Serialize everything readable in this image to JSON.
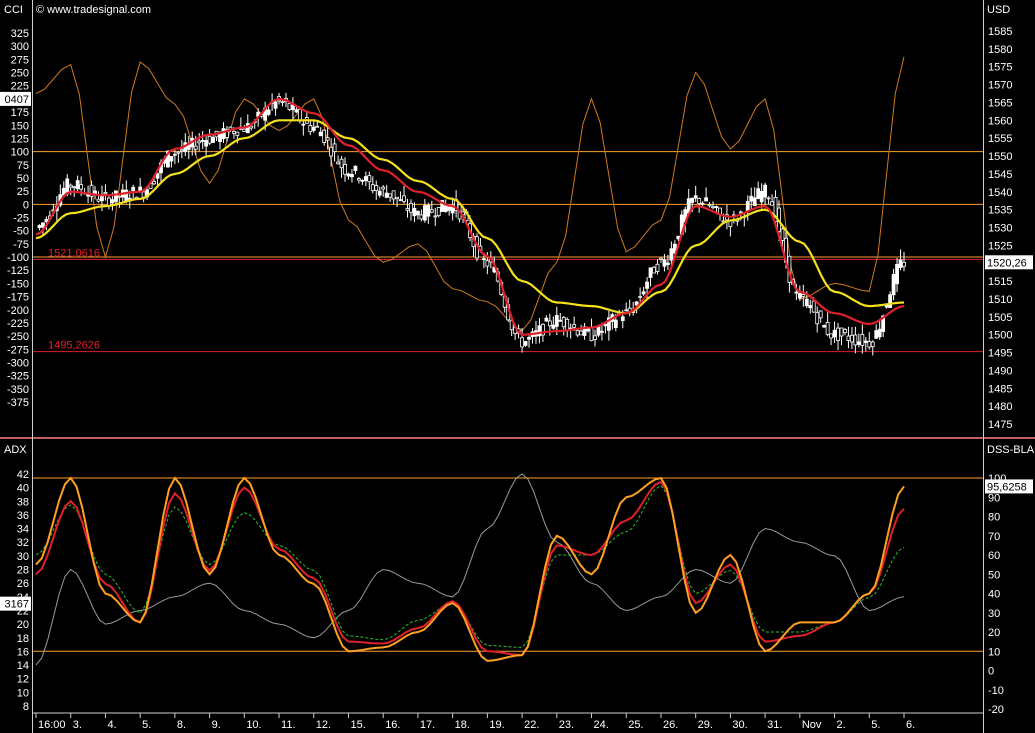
{
  "header": {
    "left_indicator": "CCI",
    "copyright": "© www.tradesignal.com",
    "currency": "USD",
    "adx_label": "ADX",
    "dss_label": "DSS-BLAU"
  },
  "upper_panel": {
    "cci_axis_ticks": [
      325,
      300,
      275,
      250,
      225,
      200,
      175,
      150,
      125,
      100,
      75,
      50,
      25,
      0,
      -25,
      -50,
      -75,
      -100,
      -125,
      -150,
      -175,
      -200,
      -225,
      -250,
      -275,
      -300,
      -325,
      -350,
      -375
    ],
    "cci_current_tag": "0407",
    "price_axis_ticks": [
      1585,
      1580,
      1575,
      1570,
      1565,
      1560,
      1555,
      1550,
      1545,
      1540,
      1535,
      1530,
      1525,
      1520,
      1515,
      1510,
      1505,
      1500,
      1495,
      1490,
      1485,
      1480,
      1475
    ],
    "price_current_tag": "1520,26",
    "level_lines": [
      {
        "kind": "cci",
        "value": 100,
        "color": "#ff9f2e"
      },
      {
        "kind": "cci",
        "value": 0,
        "color": "#ff9f2e"
      },
      {
        "kind": "cci",
        "value": -100,
        "color": "#ff9f2e"
      },
      {
        "kind": "price",
        "value": 1521.0616,
        "color": "#e0202a"
      },
      {
        "kind": "price",
        "value": 1495.2626,
        "color": "#e0202a"
      }
    ],
    "level_labels": [
      "1521,0616",
      "1495,2626"
    ]
  },
  "lower_panel": {
    "adx_axis_ticks": [
      42,
      40,
      38,
      36,
      34,
      32,
      30,
      28,
      26,
      24,
      22,
      20,
      18,
      16,
      14,
      12,
      10,
      8
    ],
    "adx_current_tag": "3167",
    "dss_axis_ticks": [
      100,
      90,
      80,
      70,
      60,
      50,
      40,
      30,
      20,
      10,
      0,
      -10,
      -20
    ],
    "dss_current_tag": "95,6258",
    "level_lines": [
      {
        "value": 100,
        "color": "#ff9f2e"
      },
      {
        "value": 10,
        "color": "#ff9f2e"
      }
    ]
  },
  "x_axis": {
    "labels": [
      "16:00",
      "3.",
      "4.",
      "5.",
      "8.",
      "9.",
      "10.",
      "11.",
      "12.",
      "15.",
      "16.",
      "17.",
      "18.",
      "19.",
      "22.",
      "23.",
      "24.",
      "25.",
      "26.",
      "29.",
      "30.",
      "31.",
      "Nov",
      "2.",
      "5.",
      "6."
    ]
  },
  "colors": {
    "background": "#000000",
    "candle": "#ffffff",
    "ma_fast": "#e0202a",
    "ma_slow": "#f4e11c",
    "cci": "#d07a1e",
    "dss_main": "#ffa020",
    "dss_signal": "#e0202a",
    "dss_dashed": "#2fbf2f",
    "adx": "#9a9a9a",
    "divider": "#ff7a7a",
    "axis_text": "#ffffff"
  },
  "chart_data": [
    {
      "type": "candlestick",
      "title": "",
      "ylabel": "USD",
      "ylim": [
        1470,
        1590
      ],
      "x": [
        "16:00",
        "3.",
        "4.",
        "5.",
        "8.",
        "9.",
        "10.",
        "11.",
        "12.",
        "15.",
        "16.",
        "17.",
        "18.",
        "19.",
        "22.",
        "23.",
        "24.",
        "25.",
        "26.",
        "29.",
        "30.",
        "31.",
        "Nov",
        "2.",
        "5.",
        "6."
      ],
      "series": [
        {
          "name": "close",
          "values": [
            1530,
            1542,
            1538,
            1540,
            1551,
            1555,
            1558,
            1565,
            1558,
            1546,
            1540,
            1534,
            1536,
            1520,
            1498,
            1504,
            1500,
            1506,
            1520,
            1538,
            1532,
            1540,
            1510,
            1500,
            1498,
            1520.26
          ]
        },
        {
          "name": "ma_fast",
          "values": [
            1528,
            1540,
            1539,
            1540,
            1552,
            1556,
            1558,
            1566,
            1562,
            1553,
            1546,
            1540,
            1536,
            1522,
            1500,
            1501,
            1502,
            1506,
            1514,
            1536,
            1533,
            1536,
            1512,
            1506,
            1503,
            1508
          ]
        },
        {
          "name": "ma_slow",
          "values": [
            1527,
            1534,
            1536,
            1538,
            1545,
            1550,
            1555,
            1560,
            1560,
            1555,
            1549,
            1543,
            1538,
            1527,
            1515,
            1509,
            1508,
            1506,
            1512,
            1525,
            1532,
            1535,
            1526,
            1512,
            1508,
            1509
          ]
        },
        {
          "name": "CCI",
          "values": [
            210,
            265,
            -100,
            270,
            190,
            40,
            200,
            140,
            200,
            -30,
            -110,
            -75,
            -160,
            -185,
            -240,
            -110,
            200,
            -90,
            -30,
            250,
            105,
            200,
            -180,
            -150,
            -165,
            280
          ]
        }
      ]
    },
    {
      "type": "line",
      "title": "",
      "ylim": [
        -20,
        100
      ],
      "x": [
        "16:00",
        "3.",
        "4.",
        "5.",
        "8.",
        "9.",
        "10.",
        "11.",
        "12.",
        "15.",
        "16.",
        "17.",
        "18.",
        "19.",
        "22.",
        "23.",
        "24.",
        "25.",
        "26.",
        "29.",
        "30.",
        "31.",
        "Nov",
        "2.",
        "5.",
        "6."
      ],
      "series": [
        {
          "name": "DSS",
          "values": [
            55,
            100,
            40,
            25,
            100,
            50,
            100,
            60,
            45,
            10,
            12,
            20,
            35,
            5,
            8,
            70,
            50,
            90,
            100,
            30,
            60,
            10,
            25,
            25,
            40,
            95.6258
          ]
        },
        {
          "name": "DSS signal",
          "values": [
            50,
            88,
            45,
            25,
            92,
            52,
            95,
            63,
            48,
            15,
            14,
            22,
            36,
            10,
            8,
            65,
            60,
            78,
            98,
            35,
            55,
            15,
            18,
            25,
            40,
            84
          ]
        },
        {
          "name": "DSS dashed",
          "values": [
            60,
            86,
            50,
            30,
            85,
            55,
            82,
            65,
            52,
            18,
            16,
            26,
            35,
            13,
            12,
            60,
            60,
            72,
            96,
            40,
            52,
            20,
            20,
            25,
            38,
            64
          ]
        },
        {
          "name": "ADX",
          "values": [
            14,
            28,
            20,
            22,
            24,
            26,
            22,
            20,
            18,
            22,
            28,
            26,
            24,
            34,
            42,
            32,
            26,
            22,
            24,
            28,
            26,
            34,
            32,
            30,
            22,
            24
          ]
        }
      ]
    }
  ]
}
